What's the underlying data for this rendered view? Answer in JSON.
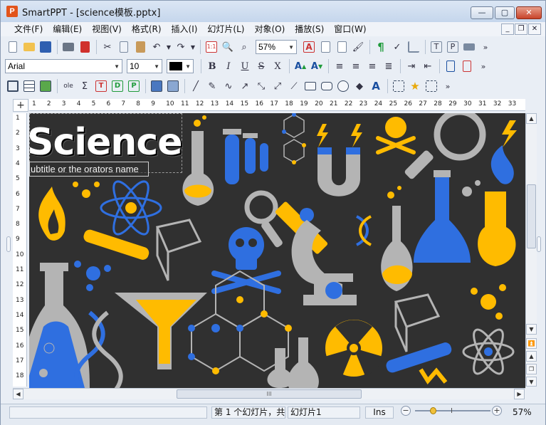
{
  "window": {
    "title": "SmartPPT - [science模板.pptx]",
    "minimize": "—",
    "maximize": "▢",
    "close": "✕"
  },
  "menu": [
    "文件(F)",
    "编辑(E)",
    "视图(V)",
    "格式(R)",
    "插入(I)",
    "幻灯片(L)",
    "对象(O)",
    "播放(S)",
    "窗口(W)"
  ],
  "mdi_controls": {
    "minimize": "_",
    "restore": "❐",
    "close": "✕"
  },
  "toolbar1": {
    "zoom": "57%",
    "icons": [
      "new-doc-icon",
      "open-folder-icon",
      "save-icon",
      "print-icon",
      "pdf-export-icon",
      "cut-icon",
      "copy-icon",
      "paste-icon",
      "undo-icon",
      "redo-icon",
      "slideshow-icon",
      "zoom-icon",
      "find-icon",
      "text-color-icon",
      "insert-slide-icon",
      "outline-icon",
      "format-brush-icon",
      "paragraph-icon",
      "spell-check-icon",
      "chart-icon",
      "text-box-icon",
      "page-icon",
      "layers-icon"
    ]
  },
  "toolbar2": {
    "font_name": "Arial",
    "font_size": "10",
    "font_color": "#000000",
    "styles": [
      "B",
      "I",
      "U",
      "S",
      "X"
    ]
  },
  "slide": {
    "title": "Science",
    "subtitle": "ubtitle or the orators name",
    "background": "#303030",
    "accent_blue": "#2f6fe0",
    "accent_yellow": "#ffbb00",
    "accent_gray": "#b4b4b4"
  },
  "hruler": [
    "1",
    "2",
    "3",
    "4",
    "5",
    "6",
    "7",
    "8",
    "9",
    "10",
    "11",
    "12",
    "13",
    "14",
    "15",
    "16",
    "17",
    "18",
    "19",
    "20",
    "21",
    "22",
    "23",
    "24",
    "25",
    "26",
    "27",
    "28",
    "29",
    "30",
    "31",
    "32",
    "33"
  ],
  "vruler": [
    "1",
    "2",
    "3",
    "4",
    "5",
    "6",
    "7",
    "8",
    "9",
    "10",
    "11",
    "12",
    "13",
    "14",
    "15",
    "16",
    "17",
    "18"
  ],
  "status": {
    "slide_info": "第 1 个幻灯片，共",
    "slide_name": "幻灯片1",
    "mode": "Ins",
    "zoom_minus": "−",
    "zoom_plus": "+",
    "zoom": "57%"
  }
}
